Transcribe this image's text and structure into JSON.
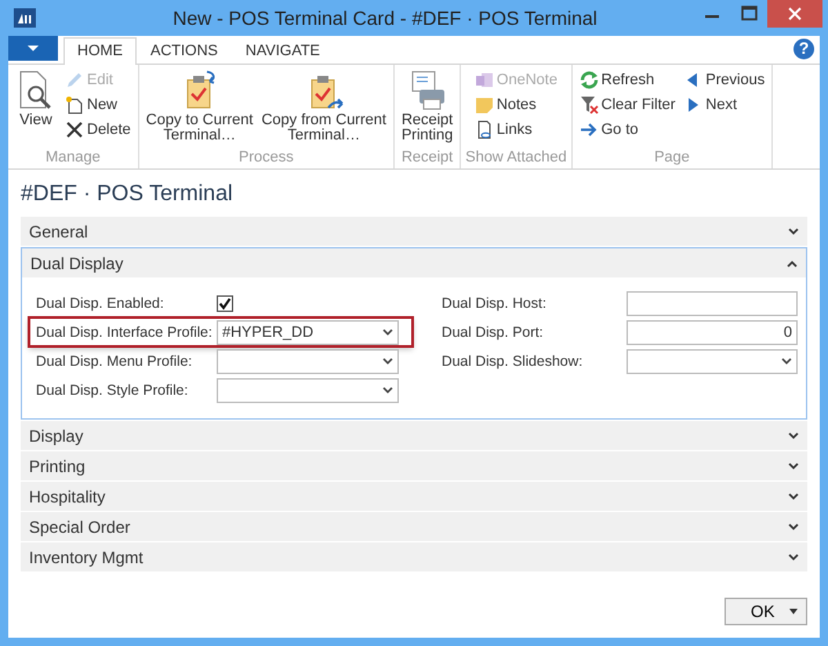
{
  "window": {
    "title": "New - POS Terminal Card - #DEF · POS Terminal"
  },
  "ribbon_tabs": [
    {
      "label": "HOME",
      "selected": true
    },
    {
      "label": "ACTIONS",
      "selected": false
    },
    {
      "label": "NAVIGATE",
      "selected": false
    }
  ],
  "help_button": "?",
  "ribbon_groups": [
    {
      "label": "Manage",
      "items": [
        {
          "kind": "large",
          "label": "View",
          "disabled": false
        },
        {
          "kind": "stack",
          "entries": [
            {
              "label": "Edit",
              "disabled": true
            },
            {
              "label": "New",
              "disabled": false
            },
            {
              "label": "Delete",
              "disabled": false
            }
          ]
        }
      ]
    },
    {
      "label": "Process",
      "items": [
        {
          "kind": "large",
          "label": "Copy to Current\nTerminal…",
          "disabled": false
        },
        {
          "kind": "large",
          "label": "Copy from Current\nTerminal…",
          "disabled": false
        }
      ]
    },
    {
      "label": "Receipt",
      "items": [
        {
          "kind": "large",
          "label": "Receipt\nPrinting",
          "disabled": false
        }
      ]
    },
    {
      "label": "Show Attached",
      "items": [
        {
          "kind": "stack",
          "entries": [
            {
              "label": "OneNote",
              "disabled": true
            },
            {
              "label": "Notes",
              "disabled": false
            },
            {
              "label": "Links",
              "disabled": false
            }
          ]
        }
      ]
    },
    {
      "label": "Page",
      "items": [
        {
          "kind": "stack",
          "entries": [
            {
              "label": "Refresh",
              "disabled": false
            },
            {
              "label": "Clear Filter",
              "disabled": false
            },
            {
              "label": "Go to",
              "disabled": false
            }
          ]
        },
        {
          "kind": "stack",
          "entries": [
            {
              "label": "Previous",
              "disabled": false
            },
            {
              "label": "Next",
              "disabled": false
            }
          ]
        }
      ]
    }
  ],
  "page_title": "#DEF · POS Terminal",
  "sections": [
    {
      "title": "General",
      "expanded": false
    },
    {
      "title": "Dual Display",
      "expanded": true,
      "left_fields": [
        {
          "label": "Dual Disp. Enabled:",
          "kind": "checkbox",
          "checked": true,
          "highlighted": false
        },
        {
          "label": "Dual Disp. Interface Profile:",
          "kind": "dropdown",
          "value": "#HYPER_DD",
          "highlighted": true
        },
        {
          "label": "Dual Disp. Menu Profile:",
          "kind": "dropdown",
          "highlighted": false
        },
        {
          "label": "Dual Disp. Style Profile:",
          "kind": "dropdown",
          "highlighted": false
        }
      ],
      "right_fields": [
        {
          "label": "Dual Disp. Host:",
          "kind": "text",
          "highlighted": false
        },
        {
          "label": "Dual Disp. Port:",
          "kind": "number",
          "value": "0",
          "highlighted": false
        },
        {
          "label": "Dual Disp. Slideshow:",
          "kind": "dropdown",
          "highlighted": false
        }
      ]
    },
    {
      "title": "Display",
      "expanded": false
    },
    {
      "title": "Printing",
      "expanded": false
    },
    {
      "title": "Hospitality",
      "expanded": false
    },
    {
      "title": "Special Order",
      "expanded": false
    },
    {
      "title": "Inventory Mgmt",
      "expanded": false
    }
  ],
  "ok_button": "OK"
}
